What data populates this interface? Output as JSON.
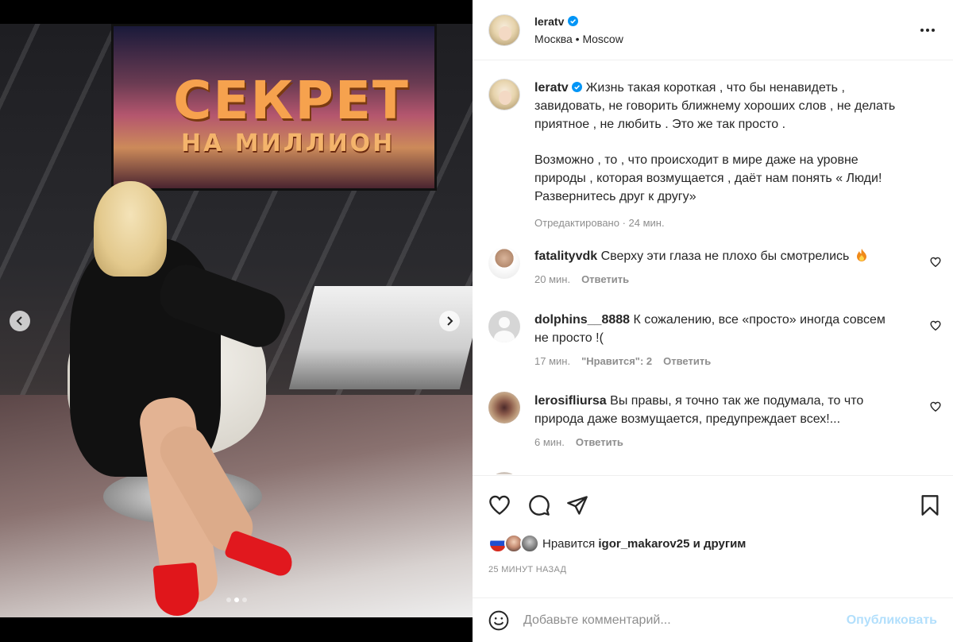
{
  "post": {
    "username": "leratv",
    "location": "Москва • Moscow",
    "screen_title": "СЕКРЕТ",
    "screen_subtitle": "НА МИЛЛИОН",
    "caption_lines": [
      "Жизнь такая короткая , что бы ненавидеть ,",
      "завидовать, не говорить ближнему хороших слов , не делать",
      "приятное , не любить . Это же так просто ."
    ],
    "caption_lines_2": [
      "Возможно , то , что происходит в мире даже на уровне",
      "природы , которая возмущается , даёт нам понять « Люди!",
      "Развернитесь друг к другу»"
    ],
    "caption_meta": "Отредактировано · 24 мин.",
    "carousel": {
      "current": 2,
      "total": 3
    }
  },
  "comments": [
    {
      "user": "fatalityvdk",
      "text": "Сверху эти глаза не плохо бы смотрелись",
      "emoji": "fire-icon",
      "time": "20 мин.",
      "likes": "",
      "reply": "Ответить"
    },
    {
      "user": "dolphins__8888",
      "text": "К сожалению, все «просто» иногда совсем",
      "text2": "не просто !(",
      "time": "17 мин.",
      "likes": "\"Нравится\": 2",
      "reply": "Ответить"
    },
    {
      "user": "lerosifliursa",
      "text": "Вы правы, я точно так же подумала, то что",
      "text2": "природа даже возмущается, предупреждает всех!...",
      "time": "6 мин.",
      "likes": "",
      "reply": "Ответить"
    }
  ],
  "likes": {
    "prefix": "Нравится",
    "user": "igor_makarov25",
    "suffix": "и другим"
  },
  "time_ago": "25 МИНУТ НАЗАД",
  "add_comment": {
    "placeholder": "Добавьте комментарий...",
    "publish": "Опубликовать"
  },
  "colors": {
    "text": "#262626",
    "muted": "#8e8e8e",
    "verified": "#0095f6",
    "publish_disabled": "#b2dffc",
    "fire": "#f08a1a"
  }
}
